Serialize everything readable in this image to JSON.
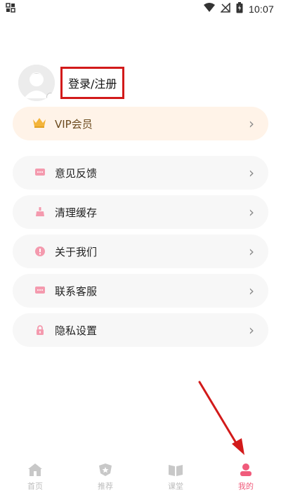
{
  "status_bar": {
    "time": "10:07"
  },
  "profile": {
    "login_label": "登录/注册"
  },
  "vip": {
    "label": "VIP会员"
  },
  "menu": [
    {
      "label": "意见反馈",
      "icon": "chat-bubble-icon"
    },
    {
      "label": "清理缓存",
      "icon": "broom-icon"
    },
    {
      "label": "关于我们",
      "icon": "info-icon"
    },
    {
      "label": "联系客服",
      "icon": "message-icon"
    },
    {
      "label": "隐私设置",
      "icon": "lock-icon"
    }
  ],
  "bottom_nav": [
    {
      "label": "首页",
      "icon": "home-icon",
      "active": false
    },
    {
      "label": "推荐",
      "icon": "shield-icon",
      "active": false
    },
    {
      "label": "课堂",
      "icon": "book-icon",
      "active": false
    },
    {
      "label": "我的",
      "icon": "profile-icon",
      "active": true
    }
  ],
  "colors": {
    "accent": "#f05b7b",
    "vip_bg": "#fff3e8",
    "annotation": "#d21a1a"
  }
}
